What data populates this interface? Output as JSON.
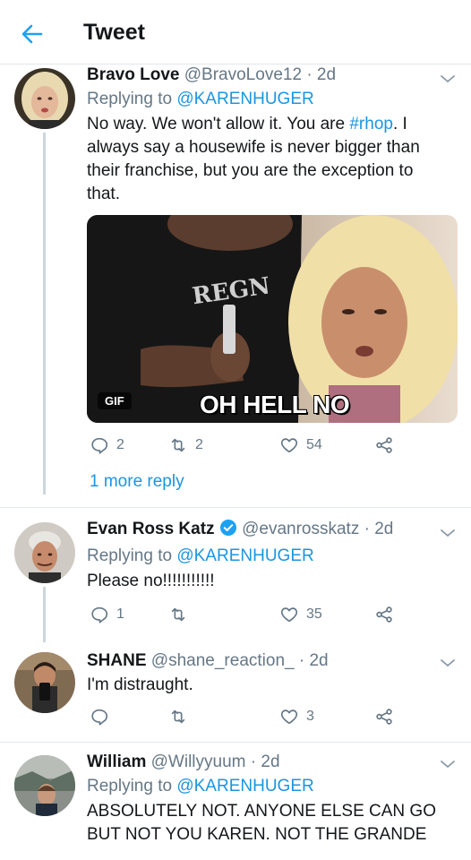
{
  "header": {
    "title": "Tweet"
  },
  "tweets": [
    {
      "name": "Bravo Love",
      "handle": "@BravoLove12",
      "time": "· 2d",
      "replying_label": "Replying to",
      "replying_to": "@KARENHUGER",
      "text_before": "No way. We won't allow it. You are ",
      "hashtag": "#rhop",
      "text_after": ". I always say a housewife is never bigger than their franchise, but you are the exception to that.",
      "gif_badge": "GIF",
      "gif_caption": "OH HELL NO",
      "gif_shirt_text": "REGN",
      "replies": "2",
      "retweets": "2",
      "likes": "54",
      "more_replies": "1 more reply"
    },
    {
      "name": "Evan Ross Katz",
      "handle": "@evanrosskatz",
      "time": "· 2d",
      "replying_label": "Replying to",
      "replying_to": "@KARENHUGER",
      "text": "Please no!!!!!!!!!!!",
      "replies": "1",
      "retweets": "",
      "likes": "35"
    },
    {
      "name": "SHANE",
      "handle": "@shane_reaction_",
      "time": "· 2d",
      "text": "I'm distraught.",
      "replies": "",
      "retweets": "",
      "likes": "3"
    },
    {
      "name": "William",
      "handle": "@Willyyuum",
      "time": "· 2d",
      "replying_label": "Replying to",
      "replying_to": "@KARENHUGER",
      "text": "ABSOLUTELY NOT. ANYONE ELSE CAN GO BUT NOT YOU KAREN. NOT THE GRANDE"
    }
  ],
  "colors": {
    "accent": "#1b95e0",
    "secondary_text": "#657786",
    "divider": "#e1e8ed"
  }
}
